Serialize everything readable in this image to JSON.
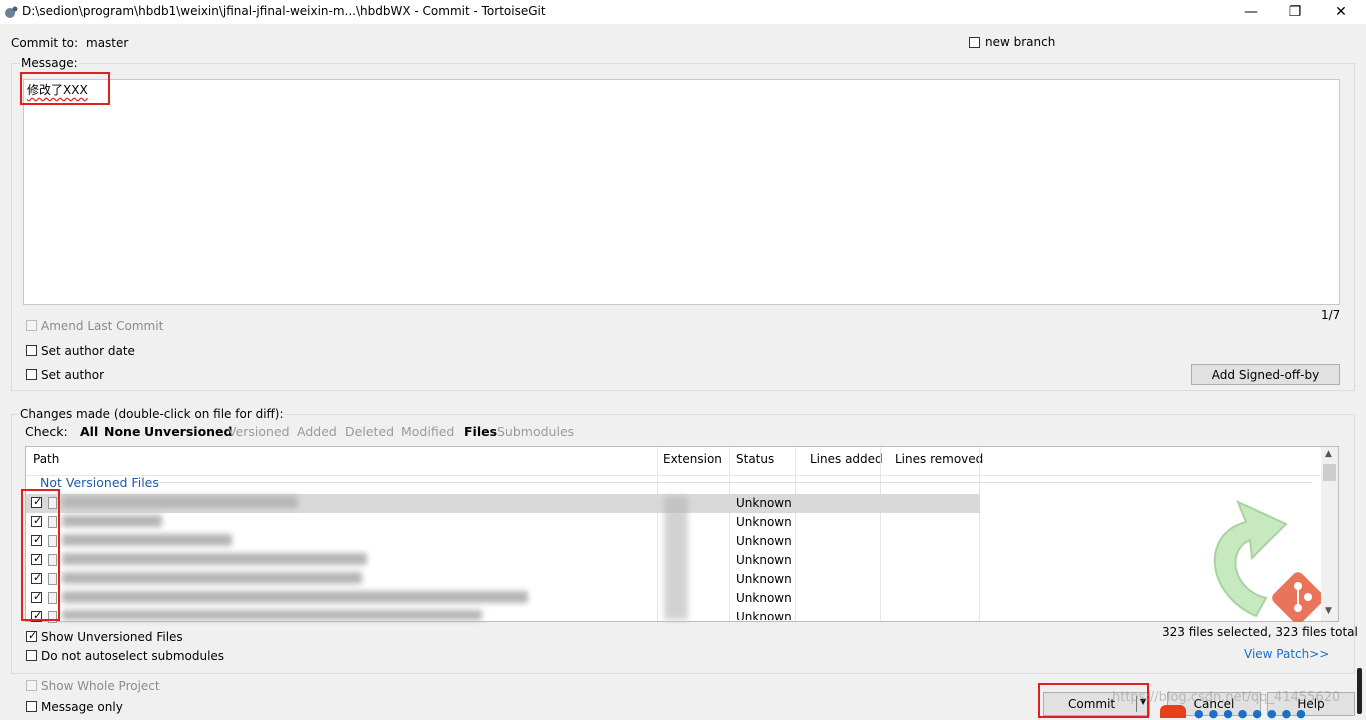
{
  "window": {
    "title": "D:\\sedion\\program\\hbdb1\\weixin\\jfinal-jfinal-weixin-m...\\hbdbWX - Commit - TortoiseGit",
    "minimize": "—",
    "restore": "❐",
    "close": "✕"
  },
  "commit_to": {
    "label": "Commit to:",
    "branch": "master"
  },
  "new_branch": {
    "label": "new branch",
    "checked": false
  },
  "message": {
    "label": "Message:",
    "text": "修改了XXX",
    "counter": "1/7"
  },
  "options": {
    "amend": "Amend Last Commit",
    "author_date": "Set author date",
    "author": "Set author",
    "signed_off": "Add Signed-off-by"
  },
  "changes": {
    "label": "Changes made (double-click on file for diff):",
    "check_label": "Check:",
    "filters": [
      "All",
      "None",
      "Unversioned",
      "Versioned",
      "Added",
      "Deleted",
      "Modified",
      "Files",
      "Submodules"
    ],
    "columns": [
      "Path",
      "Extension",
      "Status",
      "Lines added",
      "Lines removed"
    ],
    "group": "Not Versioned Files",
    "rows": [
      {
        "status": "Unknown",
        "checked": true
      },
      {
        "status": "Unknown",
        "checked": true
      },
      {
        "status": "Unknown",
        "checked": true
      },
      {
        "status": "Unknown",
        "checked": true
      },
      {
        "status": "Unknown",
        "checked": true
      },
      {
        "status": "Unknown",
        "checked": true
      },
      {
        "status": "Unknown",
        "checked": true
      }
    ],
    "summary": "323 files selected, 323 files total",
    "view_patch": "View Patch>>"
  },
  "bottom": {
    "show_unversioned": "Show Unversioned Files",
    "no_autoselect": "Do not autoselect submodules",
    "show_whole": "Show Whole Project",
    "message_only": "Message only",
    "commit": "Commit",
    "cancel": "Cancel",
    "help": "Help"
  },
  "watermark": "https://blog.csdn.net/qq_41455620",
  "colors": {
    "highlight": "#e0201a",
    "link": "#1a6fc7",
    "group": "#1e5aa8"
  }
}
